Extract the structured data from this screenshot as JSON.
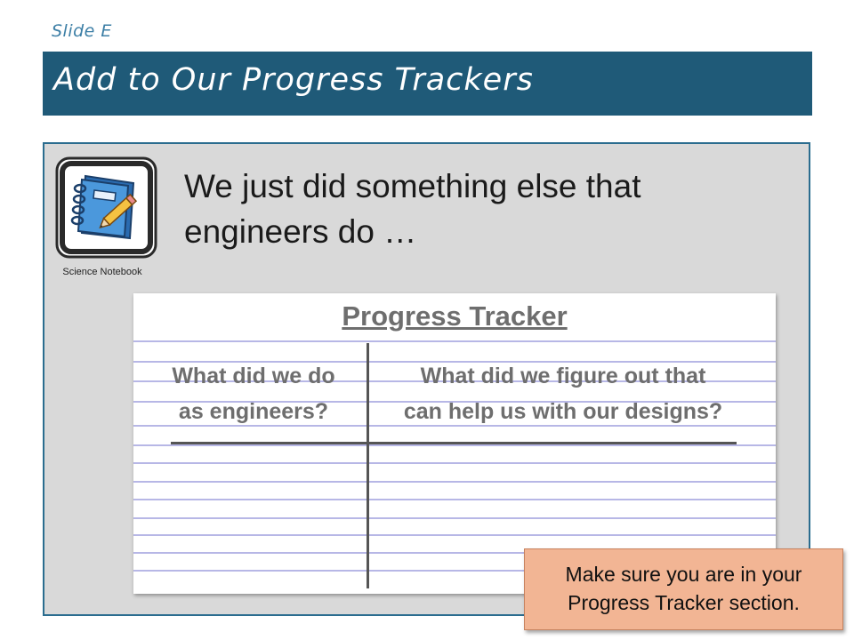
{
  "slide": {
    "label": "Slide E",
    "title": "Add to Our Progress Trackers"
  },
  "notebook": {
    "icon": "notebook-pencil-icon",
    "caption": "Science Notebook"
  },
  "headline": {
    "line1": "We just did something else that",
    "line2": "engineers do …"
  },
  "tracker": {
    "title": "Progress Tracker",
    "columns": [
      {
        "line1": "What did we do",
        "line2": "as engineers?"
      },
      {
        "line1": "What did we figure out that",
        "line2": "can help us with our designs?"
      }
    ]
  },
  "callout": {
    "line1": "Make sure you are in your",
    "line2": "Progress Tracker section."
  },
  "colors": {
    "title_bar": "#1f5a78",
    "panel_border": "#2b6d8f",
    "panel_fill": "#d9d9d9",
    "callout_fill": "#f2b594",
    "ruled_lines": "#b7b7e6"
  }
}
